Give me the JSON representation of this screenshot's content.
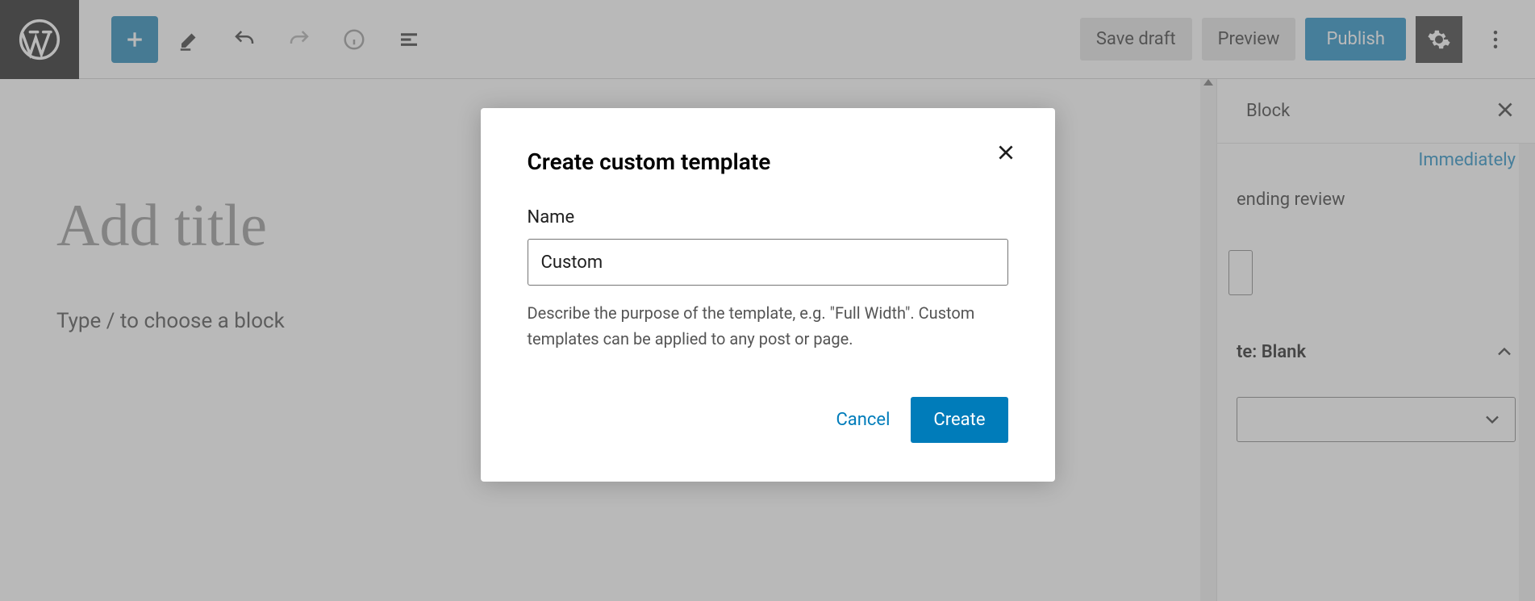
{
  "toolbar": {
    "save_draft": "Save draft",
    "preview": "Preview",
    "publish": "Publish"
  },
  "editor": {
    "title_placeholder": "Add title",
    "block_prompt": "Type / to choose a block"
  },
  "sidebar": {
    "tab_block": "Block",
    "immediately": "Immediately",
    "pending_review": "ending review",
    "panel_template": "te: Blank"
  },
  "modal": {
    "title": "Create custom template",
    "name_label": "Name",
    "name_value": "Custom",
    "help_text": "Describe the purpose of the template, e.g. \"Full Width\". Custom templates can be applied to any post or page.",
    "cancel": "Cancel",
    "create": "Create"
  }
}
